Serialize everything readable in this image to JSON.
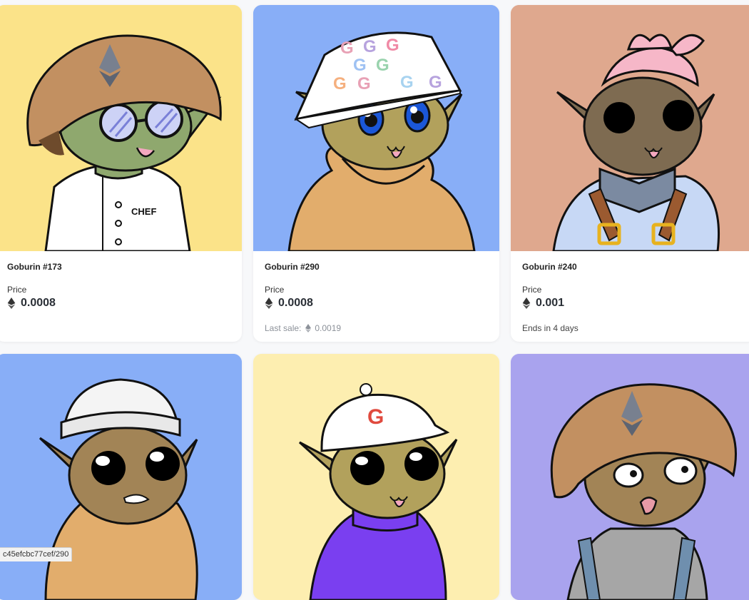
{
  "cards": [
    {
      "name": "Goburin #173",
      "price_label": "Price",
      "price": "0.0008",
      "bg": "#fbe389"
    },
    {
      "name": "Goburin #290",
      "price_label": "Price",
      "price": "0.0008",
      "bg": "#88aef7",
      "note_label": "Last sale:",
      "note_value": "0.0019"
    },
    {
      "name": "Goburin #240",
      "price_label": "Price",
      "price": "0.001",
      "bg": "#dfa88e",
      "note_label": "Ends in 4 days"
    },
    {
      "bg": "#88aef7"
    },
    {
      "bg": "#fdeeb0"
    },
    {
      "bg": "#a9a3ee"
    }
  ],
  "art_text": {
    "chef": "CHEF",
    "cap_letter": "G",
    "bucket_letter": "G"
  },
  "status_bar": {
    "url": "c45efcbc77cef/290"
  },
  "icons": {
    "currency": "ethereum-icon"
  }
}
